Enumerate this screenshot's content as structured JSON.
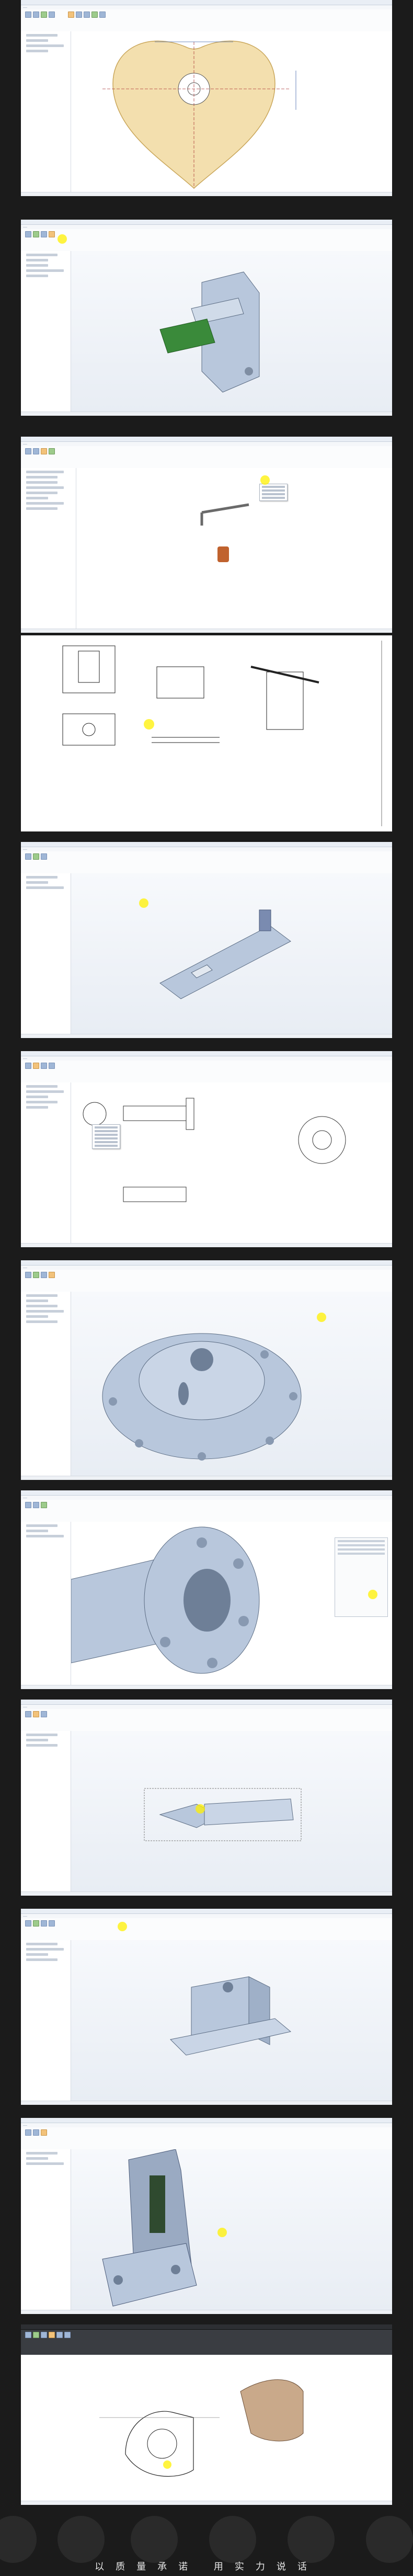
{
  "screenshots": [
    {
      "title": "",
      "menus": [
        "",
        "",
        "",
        "",
        "",
        "",
        ""
      ],
      "caption": ""
    },
    {
      "title": "",
      "menus": [
        "",
        "",
        "",
        "",
        "",
        "",
        ""
      ],
      "caption": ""
    },
    {
      "title": "",
      "menus": [
        "",
        "",
        "",
        "",
        "",
        "",
        ""
      ],
      "caption": ""
    },
    {
      "title": "",
      "menus": [],
      "caption": ""
    },
    {
      "title": "",
      "menus": [
        "",
        "",
        "",
        "",
        "",
        "",
        ""
      ],
      "caption": ""
    },
    {
      "title": "",
      "menus": [
        "",
        "",
        "",
        "",
        "",
        "",
        ""
      ],
      "caption": ""
    },
    {
      "title": "",
      "menus": [
        "",
        "",
        "",
        "",
        "",
        "",
        ""
      ],
      "caption": ""
    },
    {
      "title": "",
      "menus": [
        "",
        "",
        "",
        "",
        "",
        "",
        ""
      ],
      "caption": ""
    },
    {
      "title": "",
      "menus": [
        "",
        "",
        "",
        "",
        "",
        "",
        ""
      ],
      "caption": ""
    },
    {
      "title": "",
      "menus": [
        "",
        "",
        "",
        "",
        "",
        "",
        ""
      ],
      "caption": ""
    },
    {
      "title": "",
      "menus": [
        "",
        "",
        "",
        "",
        "",
        "",
        ""
      ],
      "caption": ""
    },
    {
      "title": "",
      "menus": [
        "",
        "",
        "",
        "",
        "",
        "",
        ""
      ],
      "caption": ""
    }
  ],
  "footer": {
    "slogan": "以质量承诺 用实力说话"
  },
  "colors": {
    "background": "#1b1b1b",
    "cad_model": "#b8c7dc",
    "cursor_highlight": "#fff000",
    "sketch_fill": "#f3dfae",
    "green_board": "#3a8a3a"
  }
}
